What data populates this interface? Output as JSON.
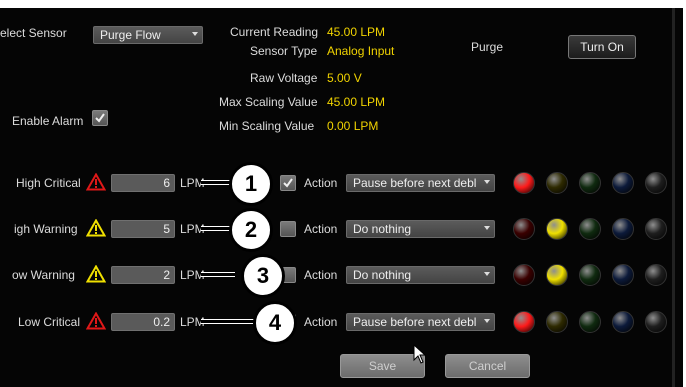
{
  "sensor": {
    "select_label": "elect Sensor",
    "selected": "Purge Flow",
    "current_reading_label": "Current Reading",
    "current_reading_value": "45.00 LPM",
    "sensor_type_label": "Sensor Type",
    "sensor_type_value": "Analog Input",
    "raw_voltage_label": "Raw Voltage",
    "raw_voltage_value": "5.00 V",
    "max_scaling_label": "Max Scaling Value",
    "max_scaling_value": "45.00 LPM",
    "min_scaling_label": "Min Scaling Value",
    "min_scaling_value": "0.00 LPM"
  },
  "purge": {
    "label": "Purge",
    "button": "Turn On"
  },
  "enable_alarm": {
    "label": "Enable Alarm",
    "checked": true
  },
  "alarms": [
    {
      "label": "High Critical",
      "value": "6",
      "unit": "LPM",
      "enabled": true,
      "action_label": "Action",
      "action": "Pause before next debl",
      "icon": "critical-icon",
      "callout": "1"
    },
    {
      "label": "igh Warning",
      "value": "5",
      "unit": "LPM",
      "enabled": false,
      "action_label": "Action",
      "action": "Do nothing",
      "icon": "warning-icon",
      "callout": "2"
    },
    {
      "label": "ow Warning",
      "value": "2",
      "unit": "LPM",
      "enabled": false,
      "action_label": "Action",
      "action": "Do nothing",
      "icon": "warning-icon",
      "callout": "3"
    },
    {
      "label": "Low Critical",
      "value": "0.2",
      "unit": "LPM",
      "enabled": false,
      "action_label": "Action",
      "action": "Pause before next debl",
      "icon": "critical-icon",
      "callout": "4"
    }
  ],
  "led_rows": [
    [
      "#ff1a1a",
      "#2e2a00",
      "#0f2a0f",
      "#0c1a3a",
      "#1e1e1e"
    ],
    [
      "#3a0000",
      "#f0e000",
      "#0f2a0f",
      "#0c1a3a",
      "#1e1e1e"
    ],
    [
      "#3a0000",
      "#f0e000",
      "#0f2a0f",
      "#0c1a3a",
      "#1e1e1e"
    ],
    [
      "#ff1a1a",
      "#2e2a00",
      "#0f2a0f",
      "#0c1a3a",
      "#1e1e1e"
    ]
  ],
  "footer": {
    "save": "Save",
    "cancel": "Cancel"
  },
  "colors": {
    "value_yellow": "#f2d400",
    "critical_red": "#e01818",
    "warning_yellow": "#f0e000"
  }
}
